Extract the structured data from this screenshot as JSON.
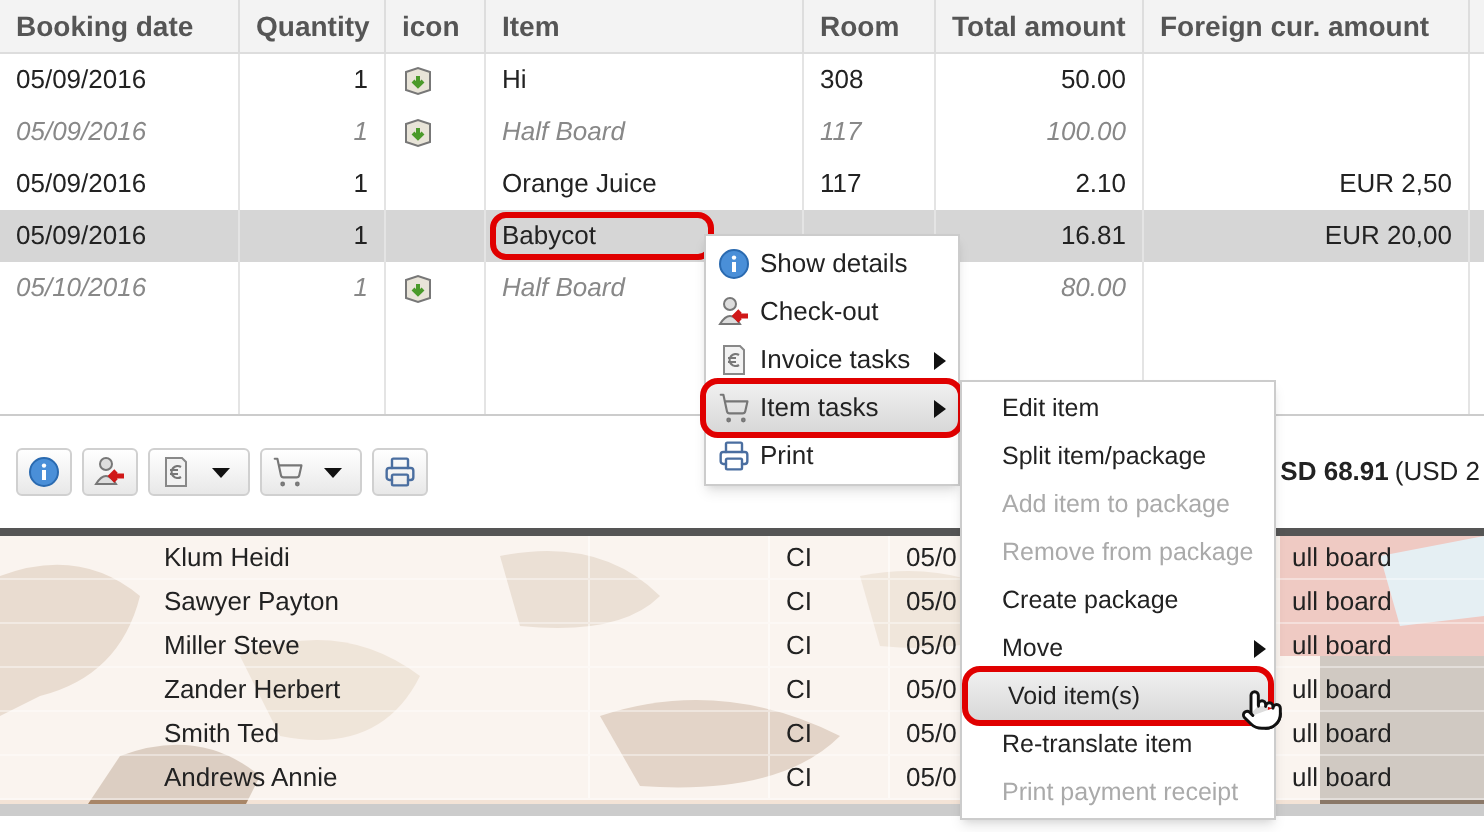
{
  "columns": [
    "Booking date",
    "Quantity",
    "icon",
    "Item",
    "Room",
    "Total amount",
    "Foreign cur. amount"
  ],
  "rows": [
    {
      "date": "05/09/2016",
      "quantity": "1",
      "has_icon": true,
      "item": "Hi",
      "room": "308",
      "total": "50.00",
      "foreign": "",
      "muted": false,
      "selected": false,
      "item_outlined": false
    },
    {
      "date": "05/09/2016",
      "quantity": "1",
      "has_icon": true,
      "item": "Half Board",
      "room": "117",
      "total": "100.00",
      "foreign": "",
      "muted": true,
      "selected": false,
      "item_outlined": false
    },
    {
      "date": "05/09/2016",
      "quantity": "1",
      "has_icon": false,
      "item": "Orange Juice",
      "room": "117",
      "total": "2.10",
      "foreign": "EUR 2,50",
      "muted": false,
      "selected": false,
      "item_outlined": false
    },
    {
      "date": "05/09/2016",
      "quantity": "1",
      "has_icon": false,
      "item": "Babycot",
      "room": "",
      "total": "16.81",
      "foreign": "EUR 20,00",
      "muted": false,
      "selected": true,
      "item_outlined": true
    },
    {
      "date": "05/10/2016",
      "quantity": "1",
      "has_icon": true,
      "item": "Half Board",
      "room": "",
      "total": "80.00",
      "foreign": "",
      "muted": true,
      "selected": false,
      "item_outlined": false
    }
  ],
  "toolbar": {
    "buttons": [
      {
        "kind": "info",
        "dropdown": false
      },
      {
        "kind": "checkout",
        "dropdown": false
      },
      {
        "kind": "invoice",
        "dropdown": true
      },
      {
        "kind": "cart",
        "dropdown": true
      },
      {
        "kind": "print",
        "dropdown": false
      }
    ],
    "total": "SD 68.91",
    "total_rest": "(USD 2"
  },
  "guests": [
    {
      "name": "Klum Heidi",
      "status": "CI",
      "date": "05/0",
      "board": "ull board"
    },
    {
      "name": "Sawyer Payton",
      "status": "CI",
      "date": "05/0",
      "board": "ull board"
    },
    {
      "name": "Miller Steve",
      "status": "CI",
      "date": "05/0",
      "board": "ull board"
    },
    {
      "name": "Zander Herbert",
      "status": "CI",
      "date": "05/0",
      "board": "ull board"
    },
    {
      "name": "Smith Ted",
      "status": "CI",
      "date": "05/0",
      "board": "ull board"
    },
    {
      "name": "Andrews Annie",
      "status": "CI",
      "date": "05/0",
      "board": "ull board"
    }
  ],
  "context_menu": [
    {
      "kind": "info",
      "label": "Show details",
      "submenu": false,
      "selected": false,
      "outlined": false
    },
    {
      "kind": "checkout",
      "label": "Check-out",
      "submenu": false,
      "selected": false,
      "outlined": false
    },
    {
      "kind": "invoice",
      "label": "Invoice tasks",
      "submenu": true,
      "selected": false,
      "outlined": false
    },
    {
      "kind": "cart",
      "label": "Item tasks",
      "submenu": true,
      "selected": true,
      "outlined": true
    },
    {
      "kind": "print",
      "label": "Print",
      "submenu": false,
      "selected": false,
      "outlined": false
    }
  ],
  "item_tasks_menu": [
    {
      "label": "Edit item",
      "disabled": false,
      "submenu": false,
      "selected": false,
      "outlined": false
    },
    {
      "label": "Split item/package",
      "disabled": false,
      "submenu": false,
      "selected": false,
      "outlined": false
    },
    {
      "label": "Add item to package",
      "disabled": true,
      "submenu": false,
      "selected": false,
      "outlined": false
    },
    {
      "label": "Remove from package",
      "disabled": true,
      "submenu": false,
      "selected": false,
      "outlined": false
    },
    {
      "label": "Create package",
      "disabled": false,
      "submenu": false,
      "selected": false,
      "outlined": false
    },
    {
      "label": "Move",
      "disabled": false,
      "submenu": true,
      "selected": false,
      "outlined": false
    },
    {
      "label": "Void item(s)",
      "disabled": false,
      "submenu": false,
      "selected": true,
      "outlined": true
    },
    {
      "label": "Re-translate item",
      "disabled": false,
      "submenu": false,
      "selected": false,
      "outlined": false
    },
    {
      "label": "Print payment receipt",
      "disabled": true,
      "submenu": false,
      "selected": false,
      "outlined": false
    }
  ]
}
